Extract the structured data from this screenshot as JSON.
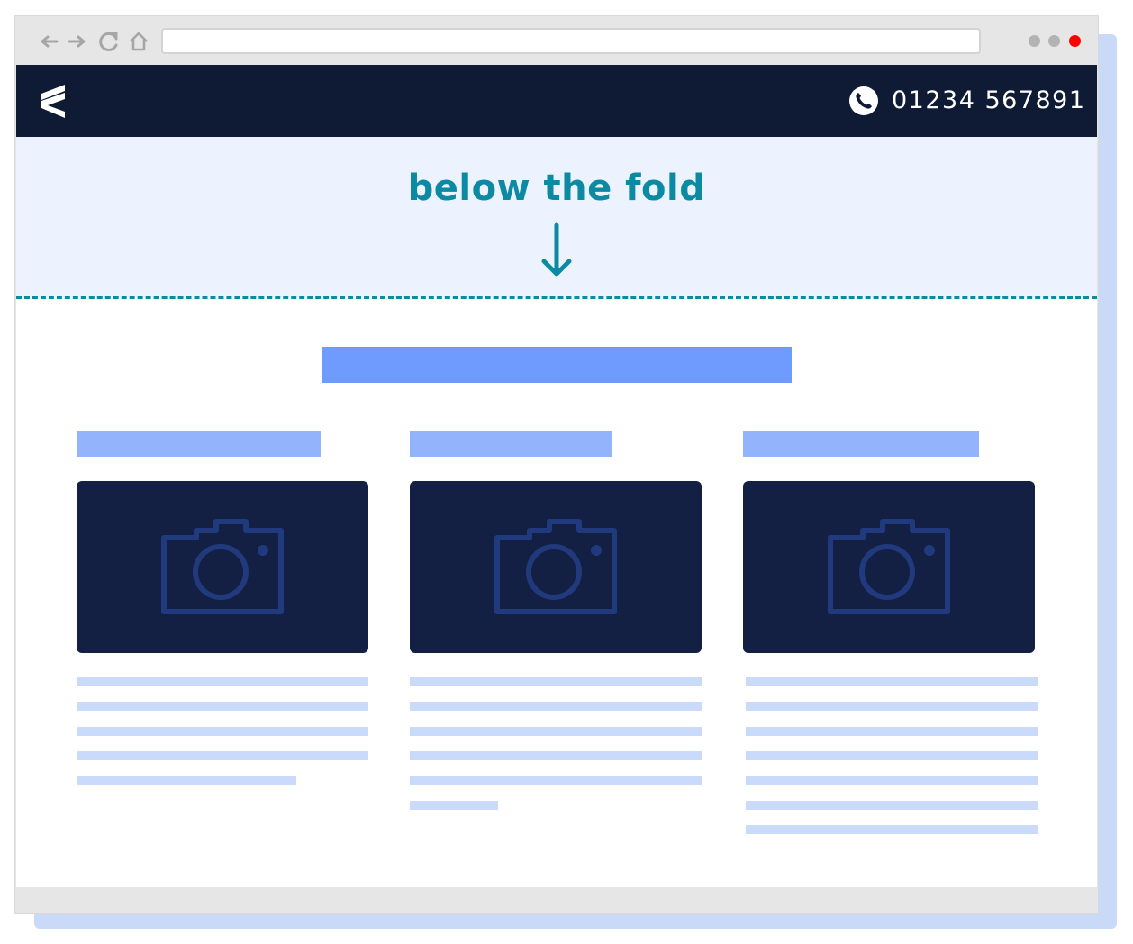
{
  "browser": {
    "url_value": "",
    "window_dots": [
      "#b3b3b3",
      "#b3b3b3",
      "#ff0000"
    ]
  },
  "header": {
    "logo_icon": "brand-logo-icon",
    "phone_icon": "phone-icon",
    "phone_number": "01234 567891"
  },
  "fold": {
    "title": "below the fold",
    "arrow_icon": "arrow-down-icon"
  },
  "colors": {
    "header_bg": "#0f1a35",
    "accent": "#0d8aa3",
    "fold_bg": "#ecf2fe",
    "placeholder_headline": "#6e9bfd",
    "placeholder_title": "#93b3fd",
    "placeholder_text": "#c9dafb",
    "photo_bg": "#132044"
  },
  "columns": [
    {
      "image_icon": "camera-icon",
      "text_lines": 5
    },
    {
      "image_icon": "camera-icon",
      "text_lines": 6
    },
    {
      "image_icon": "camera-icon",
      "text_lines": 7
    }
  ]
}
